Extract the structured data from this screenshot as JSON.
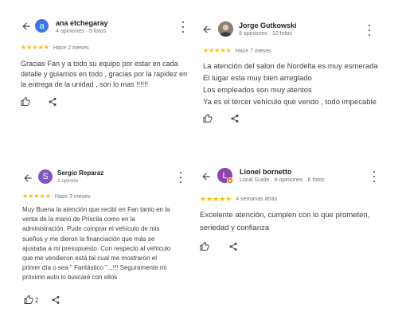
{
  "reviews": [
    {
      "avatar_letter": "a",
      "avatar_color": "#3b78e7",
      "name": "ana etchegaray",
      "meta": "4 opiniones · 5 fotos",
      "stars": "★★★★★",
      "time": "Hace 2 meses",
      "text": "Gracias Fan y a todo su equipo por estar en cada\ndetalle y guiarnos en todo , gracias por la rapidez en\nla entrega de la unidad , son lo mas !!!!!!",
      "likes": ""
    },
    {
      "avatar_letter": "",
      "avatar_color": "#6d6259",
      "name": "Jorge Gutkowski",
      "meta": "9 opiniones · 10 fotos",
      "stars": "★★★★★",
      "time": "Hace 7 meses",
      "text": "La atención del salon de Nordelta es muy esmerada\nEl lugar esta muy bien arreglado\nLos empleados son muy atentos\nYa es el tercer vehículo que vendo , todo impecable",
      "likes": ""
    },
    {
      "avatar_letter": "S",
      "avatar_color": "#7e57c2",
      "name": "Sergio Reparaz",
      "meta": "1 opinión",
      "stars": "★★★★★",
      "time": "Hace 3 meses",
      "text": "Muy Buena la atención que recibí en Fan tanto en la\nventa de la mano de Priscila como en la\nadministración. Pude comprar el vehículo de mis\nsueños y me dieron la financiación que más se\najustaba a mi presupuesto. Con respecto al vehículo\nque me vendieron está tal cual me mostraron el\nprimer día o sea \" Fantástico \"...!!! Seguramente mi\npróximo auto lo buscaré con ellos",
      "likes": "2"
    },
    {
      "avatar_letter": "L",
      "avatar_color": "#8e44ad",
      "name": "Lionel bornetto",
      "meta": "Local Guide · 9 opiniones · 6 fotos",
      "stars": "★★★★★",
      "time": "4 semanas atrás",
      "text": "Excelente atención, cumplen con lo que prometen,\nseriedad y confianza",
      "likes": ""
    }
  ]
}
